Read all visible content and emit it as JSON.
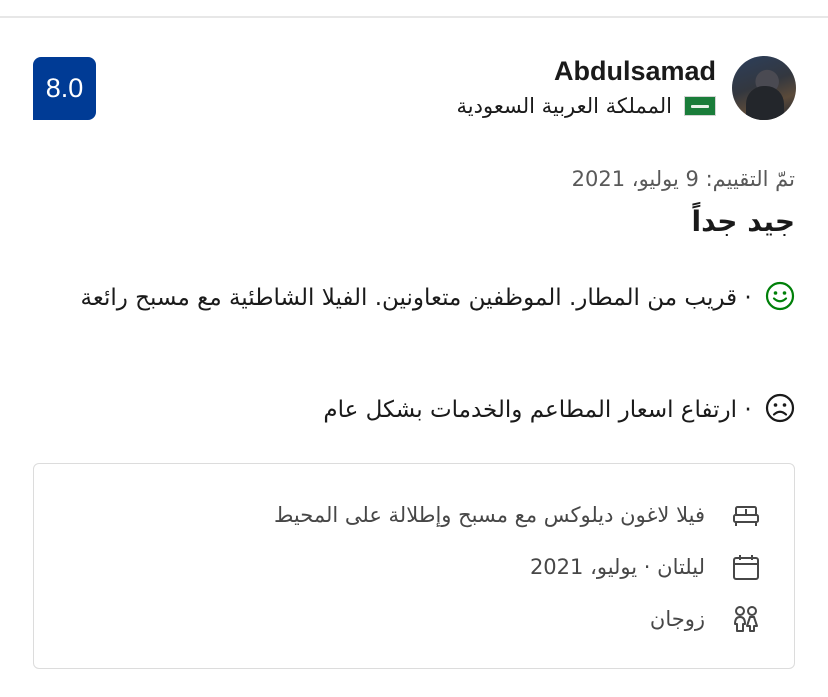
{
  "score": "8.0",
  "reviewer": {
    "name": "Abdulsamad",
    "country": "المملكة العربية السعودية",
    "flag_icon": "saudi-arabia-flag"
  },
  "review": {
    "date": "تمّ التقييم: 9 يوليو، 2021",
    "title": "جيد جداً",
    "pros": "· قريب من المطار. الموظفين متعاونين. الفيلا الشاطئية مع مسبح رائعة",
    "cons": "· ارتفاع اسعار المطاعم والخدمات بشكل عام"
  },
  "stay": {
    "room": "فيلا لاغون ديلوكس مع مسبح وإطلالة على المحيط",
    "dates": "ليلتان · يوليو، 2021",
    "travelers": "زوجان"
  },
  "colors": {
    "score_badge": "#003b95",
    "positive_icon": "#008009",
    "negative_icon": "#1a1a1a"
  }
}
